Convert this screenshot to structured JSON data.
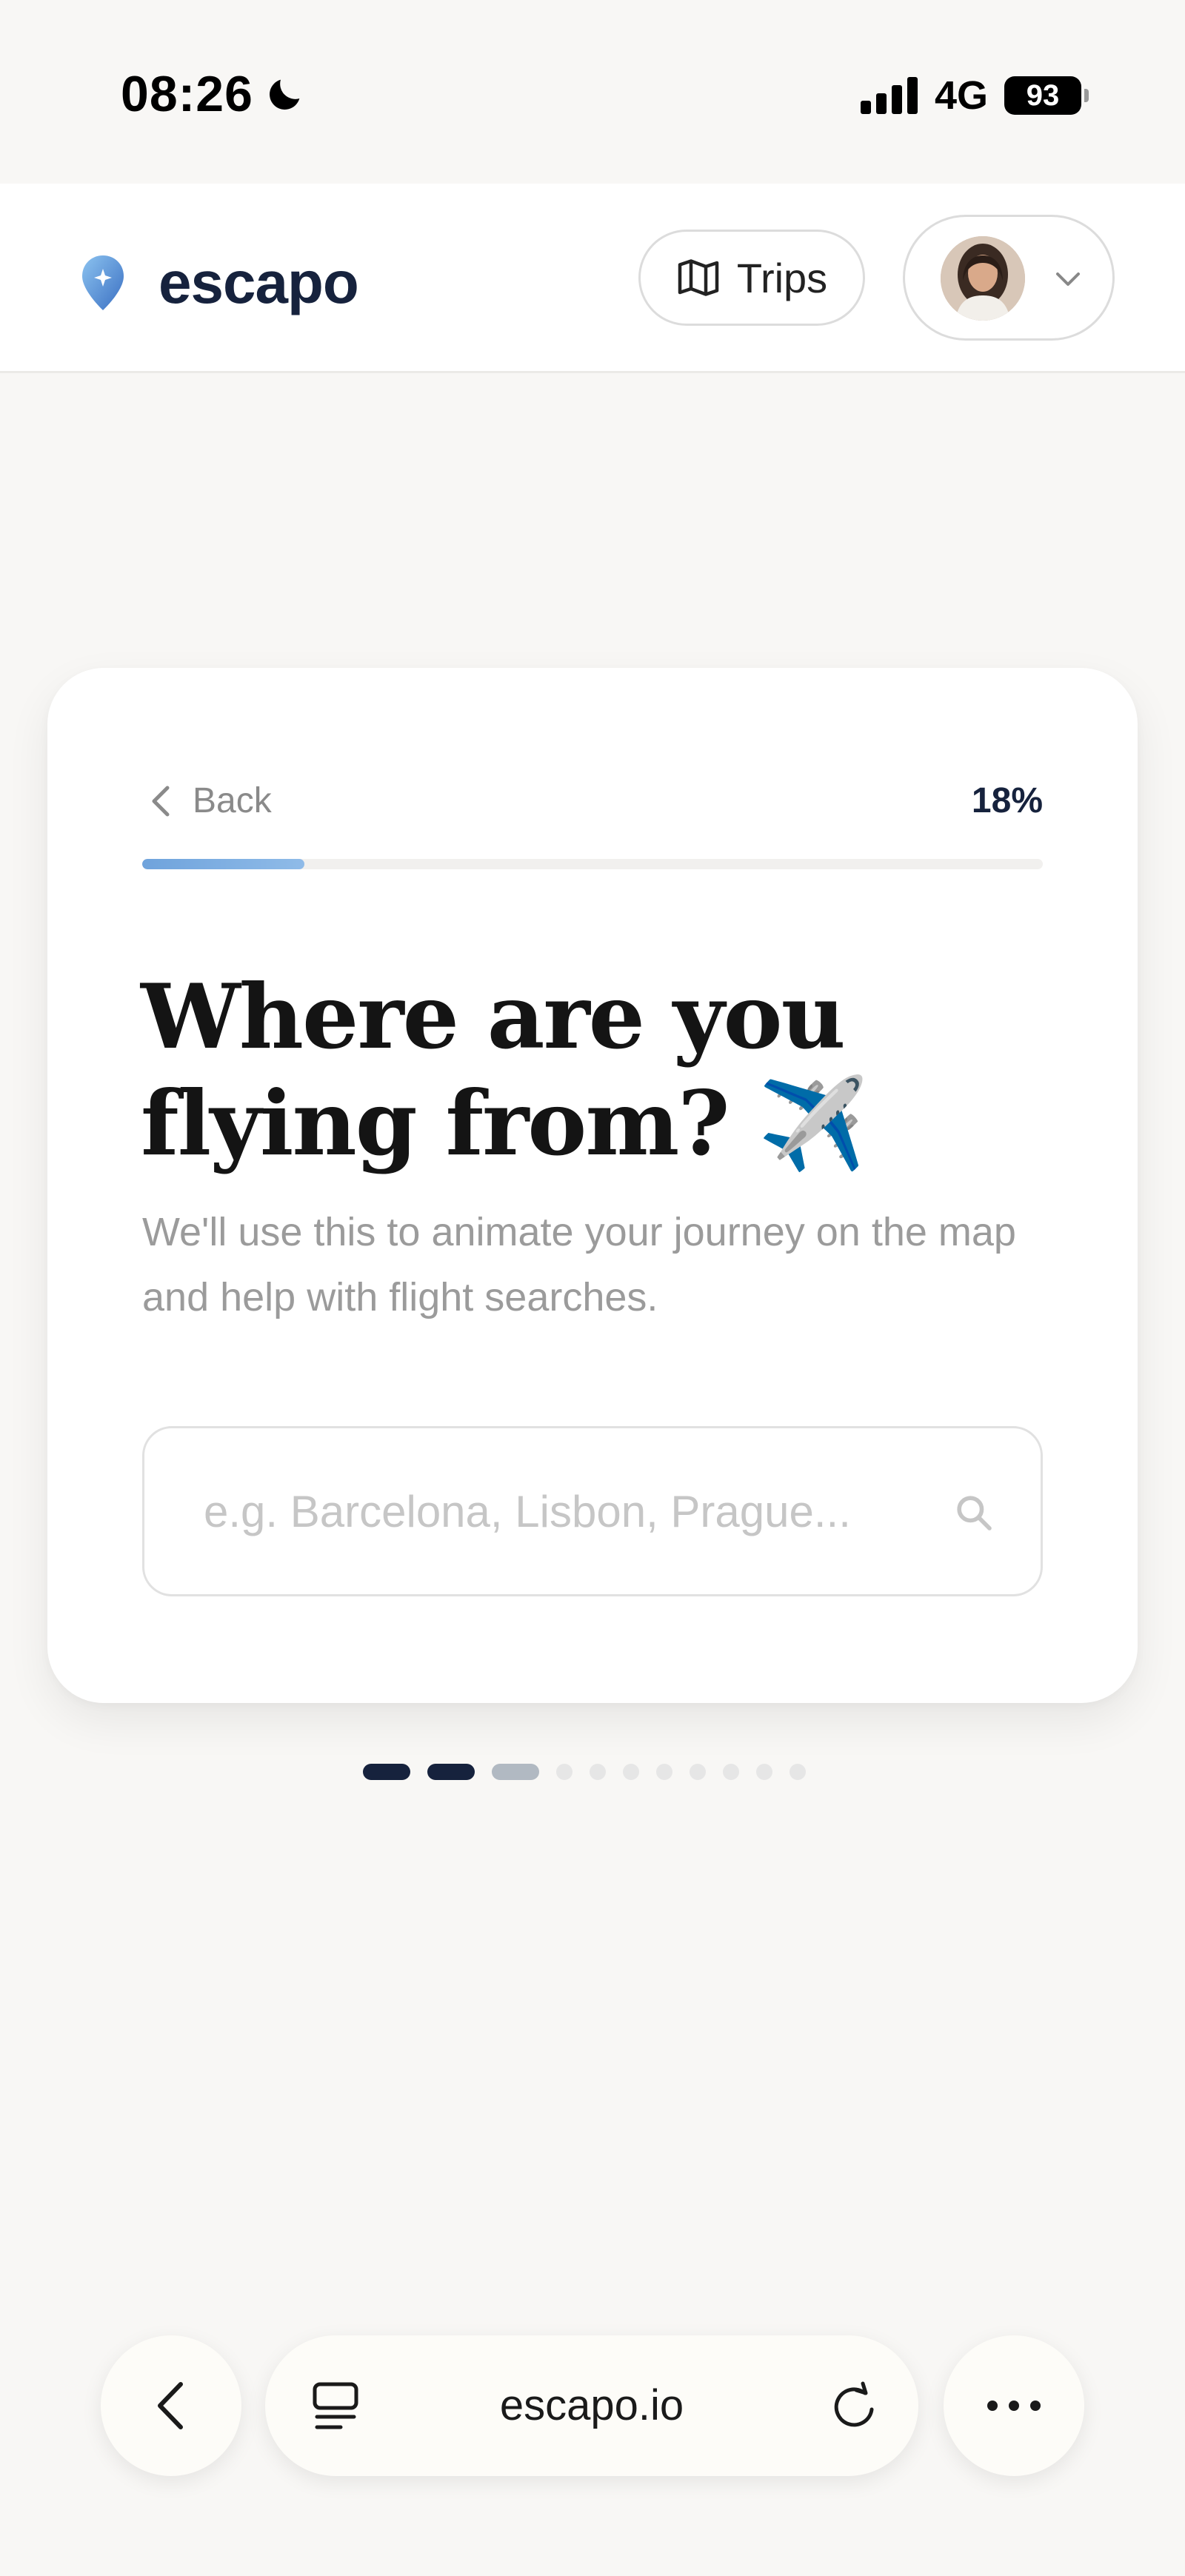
{
  "status_bar": {
    "time": "08:26",
    "network": "4G",
    "battery": "93",
    "icons": [
      "moon-icon",
      "signal-icon",
      "battery-icon"
    ]
  },
  "header": {
    "brand": "escapo",
    "trips_label": "Trips",
    "icons": [
      "location-pin-logo-icon",
      "map-icon",
      "chevron-down-icon"
    ]
  },
  "onboarding": {
    "back_label": "Back",
    "progress_label": "18%",
    "progress_fraction": 0.18,
    "title": "Where are you flying from? ✈️",
    "subtitle": "We'll use this to animate your journey on the map and help with flight searches.",
    "origin_input": {
      "value": "",
      "placeholder": "e.g. Barcelona, Lisbon, Prague..."
    },
    "steps": {
      "total": 11,
      "completed": 2,
      "current_index": 2
    }
  },
  "browser": {
    "url": "escapo.io",
    "icons": [
      "chevron-left-icon",
      "tabs-icon",
      "reload-icon",
      "more-icon"
    ]
  },
  "colors": {
    "background": "#f8f7f5",
    "brand_navy": "#16223d",
    "progress_blue": "#6fa3dc",
    "muted_text": "#9b9b9b"
  }
}
